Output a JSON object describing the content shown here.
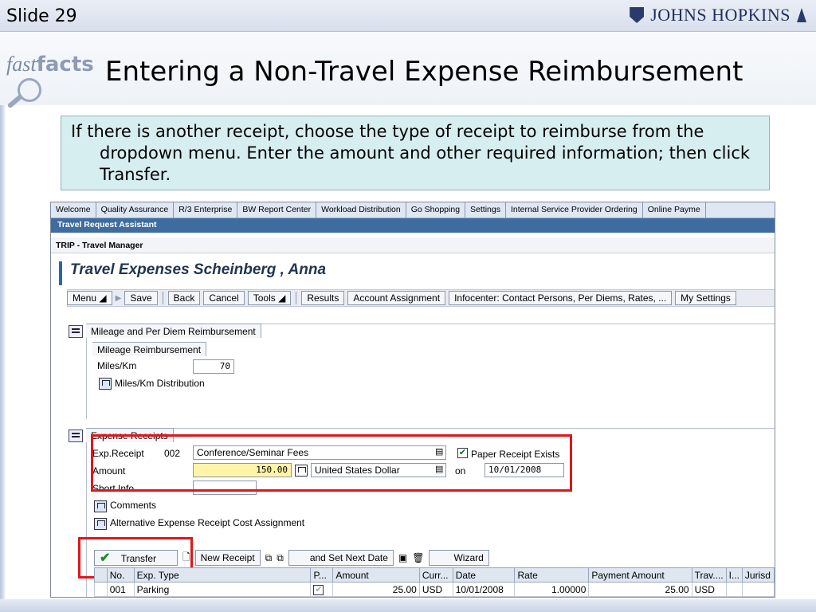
{
  "slide": {
    "number": "Slide 29",
    "logo_text": "JOHNS HOPKINS",
    "fastfacts_a": "fast",
    "fastfacts_b": "facts",
    "title": "Entering a Non-Travel Expense Reimbursement",
    "instruction": "If there is another receipt, choose the type of receipt to reimburse from the dropdown menu. Enter the amount and other required information; then click Transfer."
  },
  "sap": {
    "top_tabs": [
      "Welcome",
      "Quality Assurance",
      "R/3 Enterprise",
      "BW Report Center",
      "Workload Distribution",
      "Go Shopping",
      "Settings",
      "Internal Service Provider Ordering",
      "Online Payme"
    ],
    "sub_tab": "Travel Request Assistant",
    "trip_bar": "TRIP - Travel Manager",
    "page_title": "Travel Expenses Scheinberg , Anna",
    "toolbar": {
      "menu": "Menu",
      "save": "Save",
      "back": "Back",
      "cancel": "Cancel",
      "tools": "Tools",
      "results": "Results",
      "account_assignment": "Account Assignment",
      "infocenter": "Infocenter: Contact Persons, Per Diems, Rates, ...",
      "my_settings": "My Settings"
    },
    "mileage_section": {
      "tab": "Mileage and Per Diem Reimbursement",
      "subtab": "Mileage Reimbursement",
      "miles_label": "Miles/Km",
      "miles_value": "70",
      "distribution_label": "Miles/Km Distribution"
    },
    "expense_section": {
      "tab": "Expense Receipts",
      "exp_receipt_label": "Exp.Receipt",
      "exp_receipt_code": "002",
      "exp_receipt_value": "Conference/Seminar Fees",
      "paper_receipt_label": "Paper Receipt Exists",
      "paper_receipt_checked": true,
      "amount_label": "Amount",
      "amount_value": "150.00",
      "currency_value": "United States Dollar",
      "on_label": "on",
      "date_value": "10/01/2008",
      "short_info_label": "Short Info",
      "comments_label": "Comments",
      "alt_cost_label": "Alternative Expense Receipt Cost Assignment"
    },
    "table_toolbar": {
      "transfer": "Transfer",
      "new_receipt": "New Receipt",
      "set_next_date": "and Set Next Date",
      "wizard": "Wizard"
    },
    "table": {
      "headers": [
        "No.",
        "Exp. Type",
        "P...",
        "Amount",
        "Curr...",
        "Date",
        "Rate",
        "Payment Amount",
        "Trav....",
        "I...",
        "Jurisd"
      ],
      "rows": [
        [
          "001",
          "Parking",
          "",
          "25.00",
          "USD",
          "10/01/2008",
          "1.00000",
          "25.00",
          "USD",
          "",
          ""
        ]
      ]
    }
  }
}
